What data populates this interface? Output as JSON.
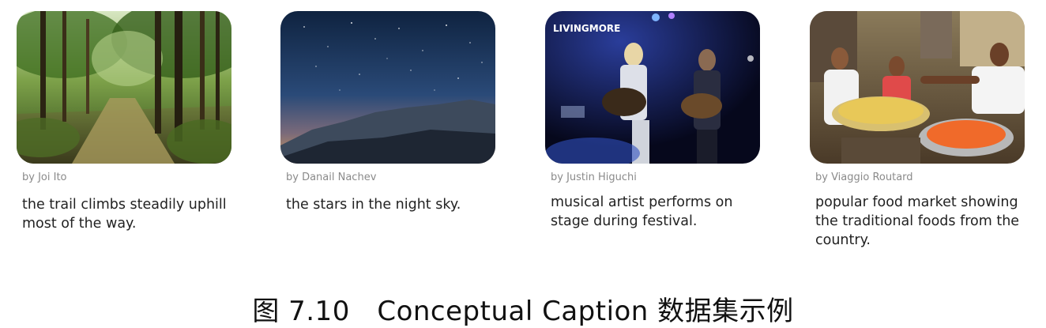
{
  "cards": [
    {
      "image_subject": "forest trail",
      "credit": "by Joi Ito",
      "caption": "the trail climbs steadily uphill most of the way."
    },
    {
      "image_subject": "night sky over mountains",
      "credit": "by Danail Nachev",
      "caption": "the stars in the night sky."
    },
    {
      "image_subject": "musicians performing on stage",
      "credit": "by Justin Higuchi",
      "caption": "musical artist performs on stage during festival.",
      "sign_text": "LIVINGMORE"
    },
    {
      "image_subject": "street food market",
      "credit": "by Viaggio Routard",
      "caption": "popular food market showing the traditional foods from the country."
    }
  ],
  "figure_caption": "图 7.10　Conceptual Caption 数据集示例"
}
